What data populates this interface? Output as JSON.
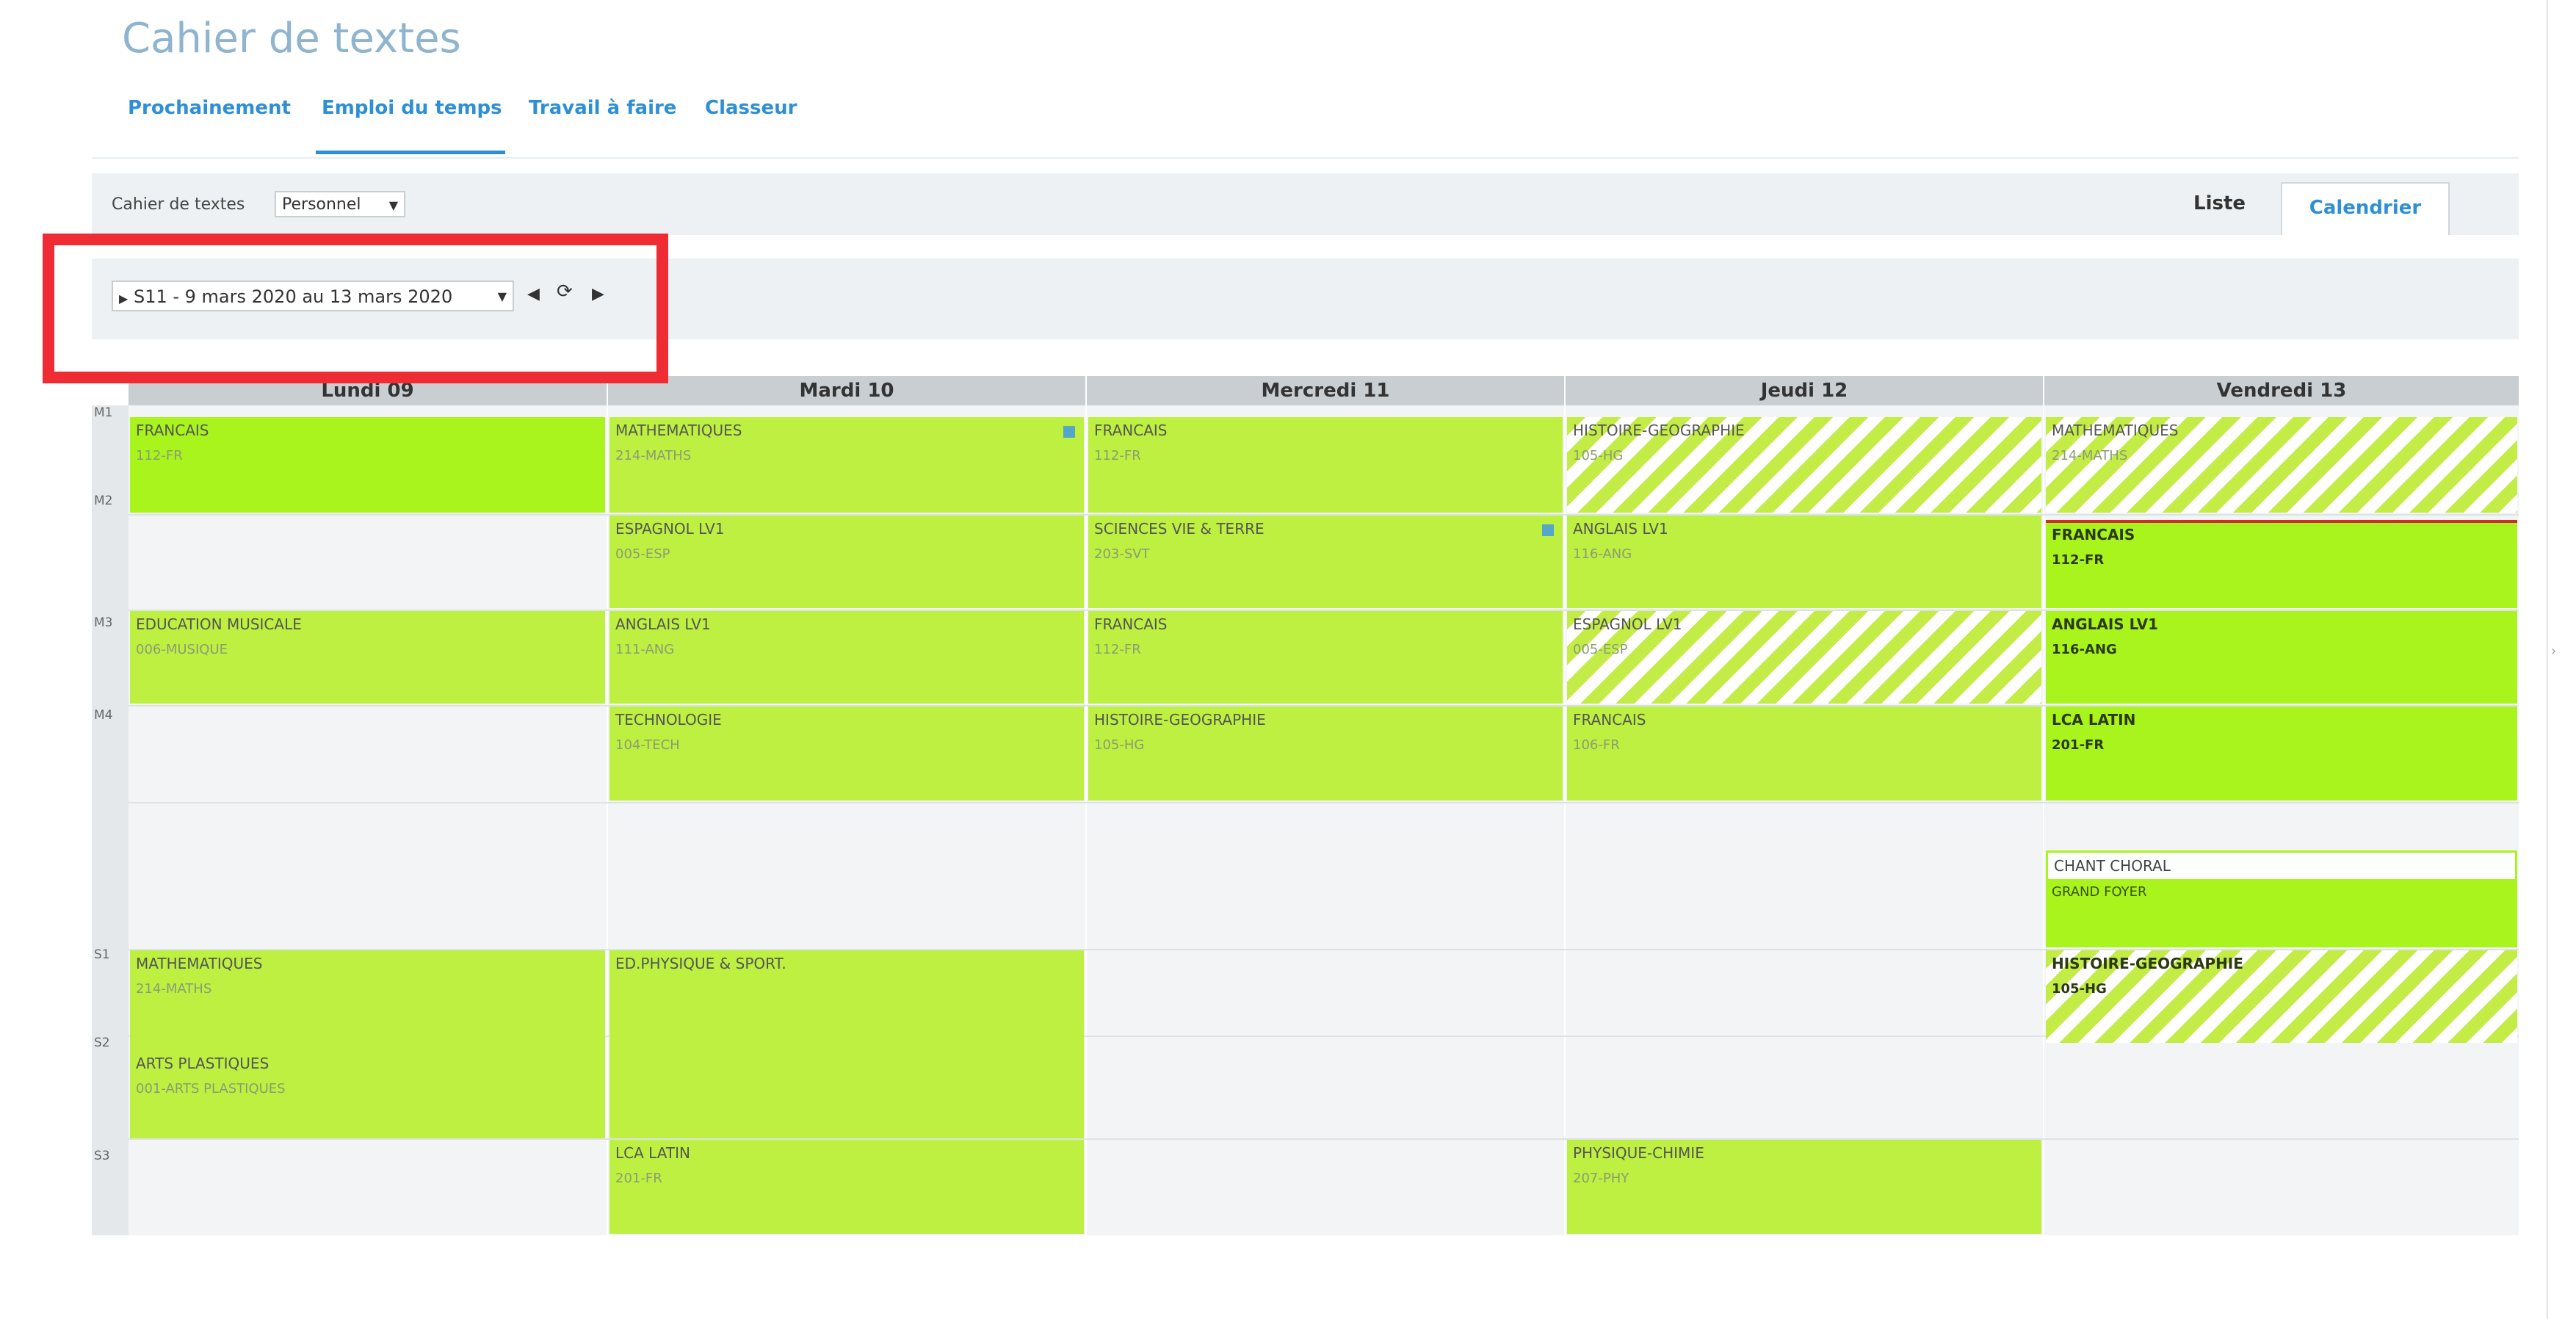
{
  "app": {
    "title": "Cahier de textes"
  },
  "nav": [
    {
      "label": "Prochainement"
    },
    {
      "label": "Emploi du temps"
    },
    {
      "label": "Travail à faire"
    },
    {
      "label": "Classeur"
    }
  ],
  "toolbar": {
    "label": "Cahier de textes",
    "select_value": "Personnel",
    "view_tabs": [
      {
        "label": "Liste"
      },
      {
        "label": "Calendrier"
      }
    ]
  },
  "week": {
    "selected": "S11 - 9 mars 2020 au 13 mars 2020"
  },
  "calendar": {
    "days": [
      "Lundi 09",
      "Mardi 10",
      "Mercredi 11",
      "Jeudi 12",
      "Vendredi 13"
    ],
    "slots": [
      "M1",
      "M2",
      "M3",
      "M4",
      "S1",
      "S2",
      "S3"
    ],
    "lessons": {
      "mon1": {
        "subject": "FRANCAIS",
        "room": "112-FR"
      },
      "mon2": {
        "subject": "EDUCATION MUSICALE",
        "room": "006-MUSIQUE"
      },
      "mon3": {
        "subject": "MATHEMATIQUES",
        "room": "214-MATHS"
      },
      "mon4": {
        "subject": "ARTS PLASTIQUES",
        "room": "001-ARTS PLASTIQUES"
      },
      "tue1": {
        "subject": "MATHEMATIQUES",
        "room": "214-MATHS"
      },
      "tue2": {
        "subject": "ESPAGNOL LV1",
        "room": "005-ESP"
      },
      "tue3": {
        "subject": "ANGLAIS LV1",
        "room": "111-ANG"
      },
      "tue4": {
        "subject": "TECHNOLOGIE",
        "room": "104-TECH"
      },
      "tue5": {
        "subject": "ED.PHYSIQUE & SPORT.",
        "room": ""
      },
      "tue6": {
        "subject": "LCA LATIN",
        "room": "201-FR"
      },
      "wed1": {
        "subject": "FRANCAIS",
        "room": "112-FR"
      },
      "wed2": {
        "subject": "SCIENCES VIE & TERRE",
        "room": "203-SVT"
      },
      "wed3": {
        "subject": "FRANCAIS",
        "room": "112-FR"
      },
      "wed4": {
        "subject": "HISTOIRE-GEOGRAPHIE",
        "room": "105-HG"
      },
      "thu1": {
        "subject": "HISTOIRE-GEOGRAPHIE",
        "room": "105-HG"
      },
      "thu2": {
        "subject": "ANGLAIS LV1",
        "room": "116-ANG"
      },
      "thu3": {
        "subject": "ESPAGNOL LV1",
        "room": "005-ESP"
      },
      "thu4": {
        "subject": "FRANCAIS",
        "room": "106-FR"
      },
      "thu5": {
        "subject": "PHYSIQUE-CHIMIE",
        "room": "207-PHY"
      },
      "fri1": {
        "subject": "MATHEMATIQUES",
        "room": "214-MATHS"
      },
      "fri2": {
        "subject": "FRANCAIS",
        "room": "112-FR"
      },
      "fri3": {
        "subject": "ANGLAIS LV1",
        "room": "116-ANG"
      },
      "fri4": {
        "subject": "LCA LATIN",
        "room": "201-FR"
      },
      "fri5": {
        "subject": "CHANT CHORAL",
        "room": "GRAND FOYER"
      },
      "fri6": {
        "subject": "HISTOIRE-GEOGRAPHIE",
        "room": "105-HG"
      }
    }
  },
  "colors": {
    "lesson": "#bdf040",
    "lesson_bright": "#a8f41c",
    "accent": "#2e8fd6",
    "highlight_box": "#ef2b34"
  }
}
